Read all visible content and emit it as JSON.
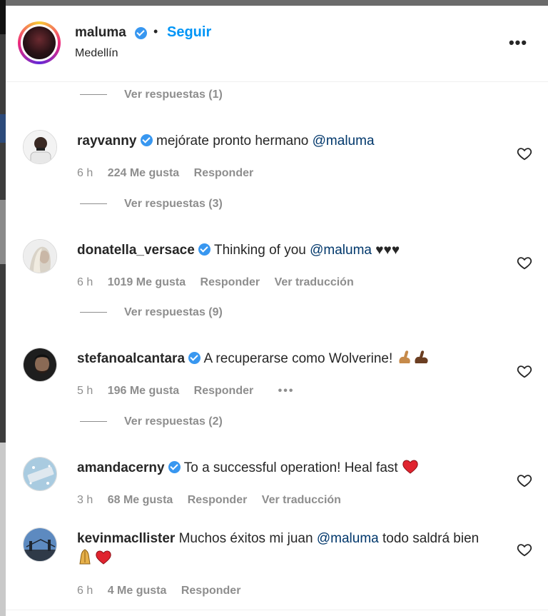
{
  "post": {
    "username": "maluma",
    "follow_label": "Seguir",
    "separator": "•",
    "location": "Medellín",
    "more_label": "•••"
  },
  "replies": [
    {
      "label": "Ver respuestas (1)"
    },
    {
      "label": "Ver respuestas (3)"
    },
    {
      "label": "Ver respuestas (9)"
    },
    {
      "label": "Ver respuestas (2)"
    }
  ],
  "comments": [
    {
      "username": "rayvanny",
      "text": "mejórate pronto hermano ",
      "mention": "@maluma",
      "time": "6 h",
      "likes": "224 Me gusta",
      "reply": "Responder"
    },
    {
      "username": "donatella_versace",
      "text": "Thinking of you ",
      "mention": "@maluma",
      "suffix": " ♥♥♥",
      "time": "6 h",
      "likes": "1019 Me gusta",
      "reply": "Responder",
      "translate": "Ver traducción"
    },
    {
      "username": "stefanoalcantara",
      "text": "A recuperarse como Wolverine! ",
      "time": "5 h",
      "likes": "196 Me gusta",
      "reply": "Responder",
      "more": "•••"
    },
    {
      "username": "amandacerny",
      "text": "To a successful operation! Heal fast ",
      "time": "3 h",
      "likes": "68 Me gusta",
      "reply": "Responder",
      "translate": "Ver traducción"
    },
    {
      "username": "kevinmacllister",
      "text": "Muchos éxitos mi juan ",
      "mention": "@maluma",
      "suffix": " todo saldrá bien ",
      "time": "6 h",
      "likes": "4 Me gusta",
      "reply": "Responder"
    }
  ],
  "colors": {
    "accent": "#0095f6",
    "mention": "#00376b",
    "muted": "#8e8e8e",
    "verified": "#3897f0",
    "heart_red": "#ed4956"
  }
}
